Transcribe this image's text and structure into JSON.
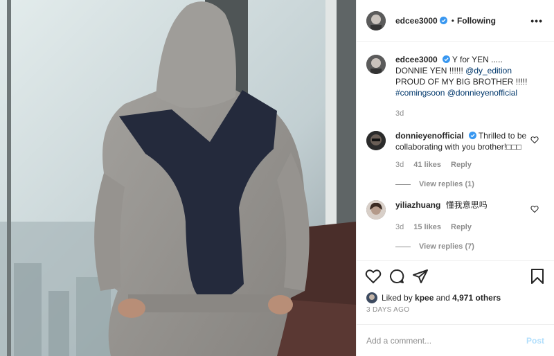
{
  "header": {
    "username": "edcee3000",
    "separator": "•",
    "follow_state": "Following",
    "more": "•••"
  },
  "caption": {
    "username": "edcee3000",
    "text_before": "Y for YEN ..... DONNIE YEN !!!!!! ",
    "mention1": "@dy_edition",
    "text_middle": " PROUD OF MY BIG BROTHER !!!!! ",
    "hashtag": "#comingsoon",
    "mention2": "@donnieyenofficial",
    "age": "3d"
  },
  "comments": [
    {
      "username": "donnieyenofficial",
      "text": "Thrilled to be collaborating with you brother!□□□",
      "age": "3d",
      "likes": "41 likes",
      "reply": "Reply",
      "view_replies": "View replies (1)"
    },
    {
      "username": "yiliazhuang",
      "text": "懂我意思吗",
      "age": "3d",
      "likes": "15 likes",
      "reply": "Reply",
      "view_replies": "View replies (7)"
    }
  ],
  "likes_line": {
    "prefix": "Liked by ",
    "user": "kpee",
    "middle": " and ",
    "count": "4,971 others"
  },
  "date": "3 DAYS AGO",
  "add_comment": {
    "placeholder": "Add a comment...",
    "post": "Post"
  },
  "colors": {
    "verified": "#3897f0",
    "link": "#00376b",
    "post_disabled": "#b2dffc",
    "secondary_text": "#8e8e8e"
  },
  "icons": [
    "heart-icon",
    "comment-icon",
    "share-icon",
    "bookmark-icon",
    "verified-badge-icon",
    "more-icon"
  ]
}
